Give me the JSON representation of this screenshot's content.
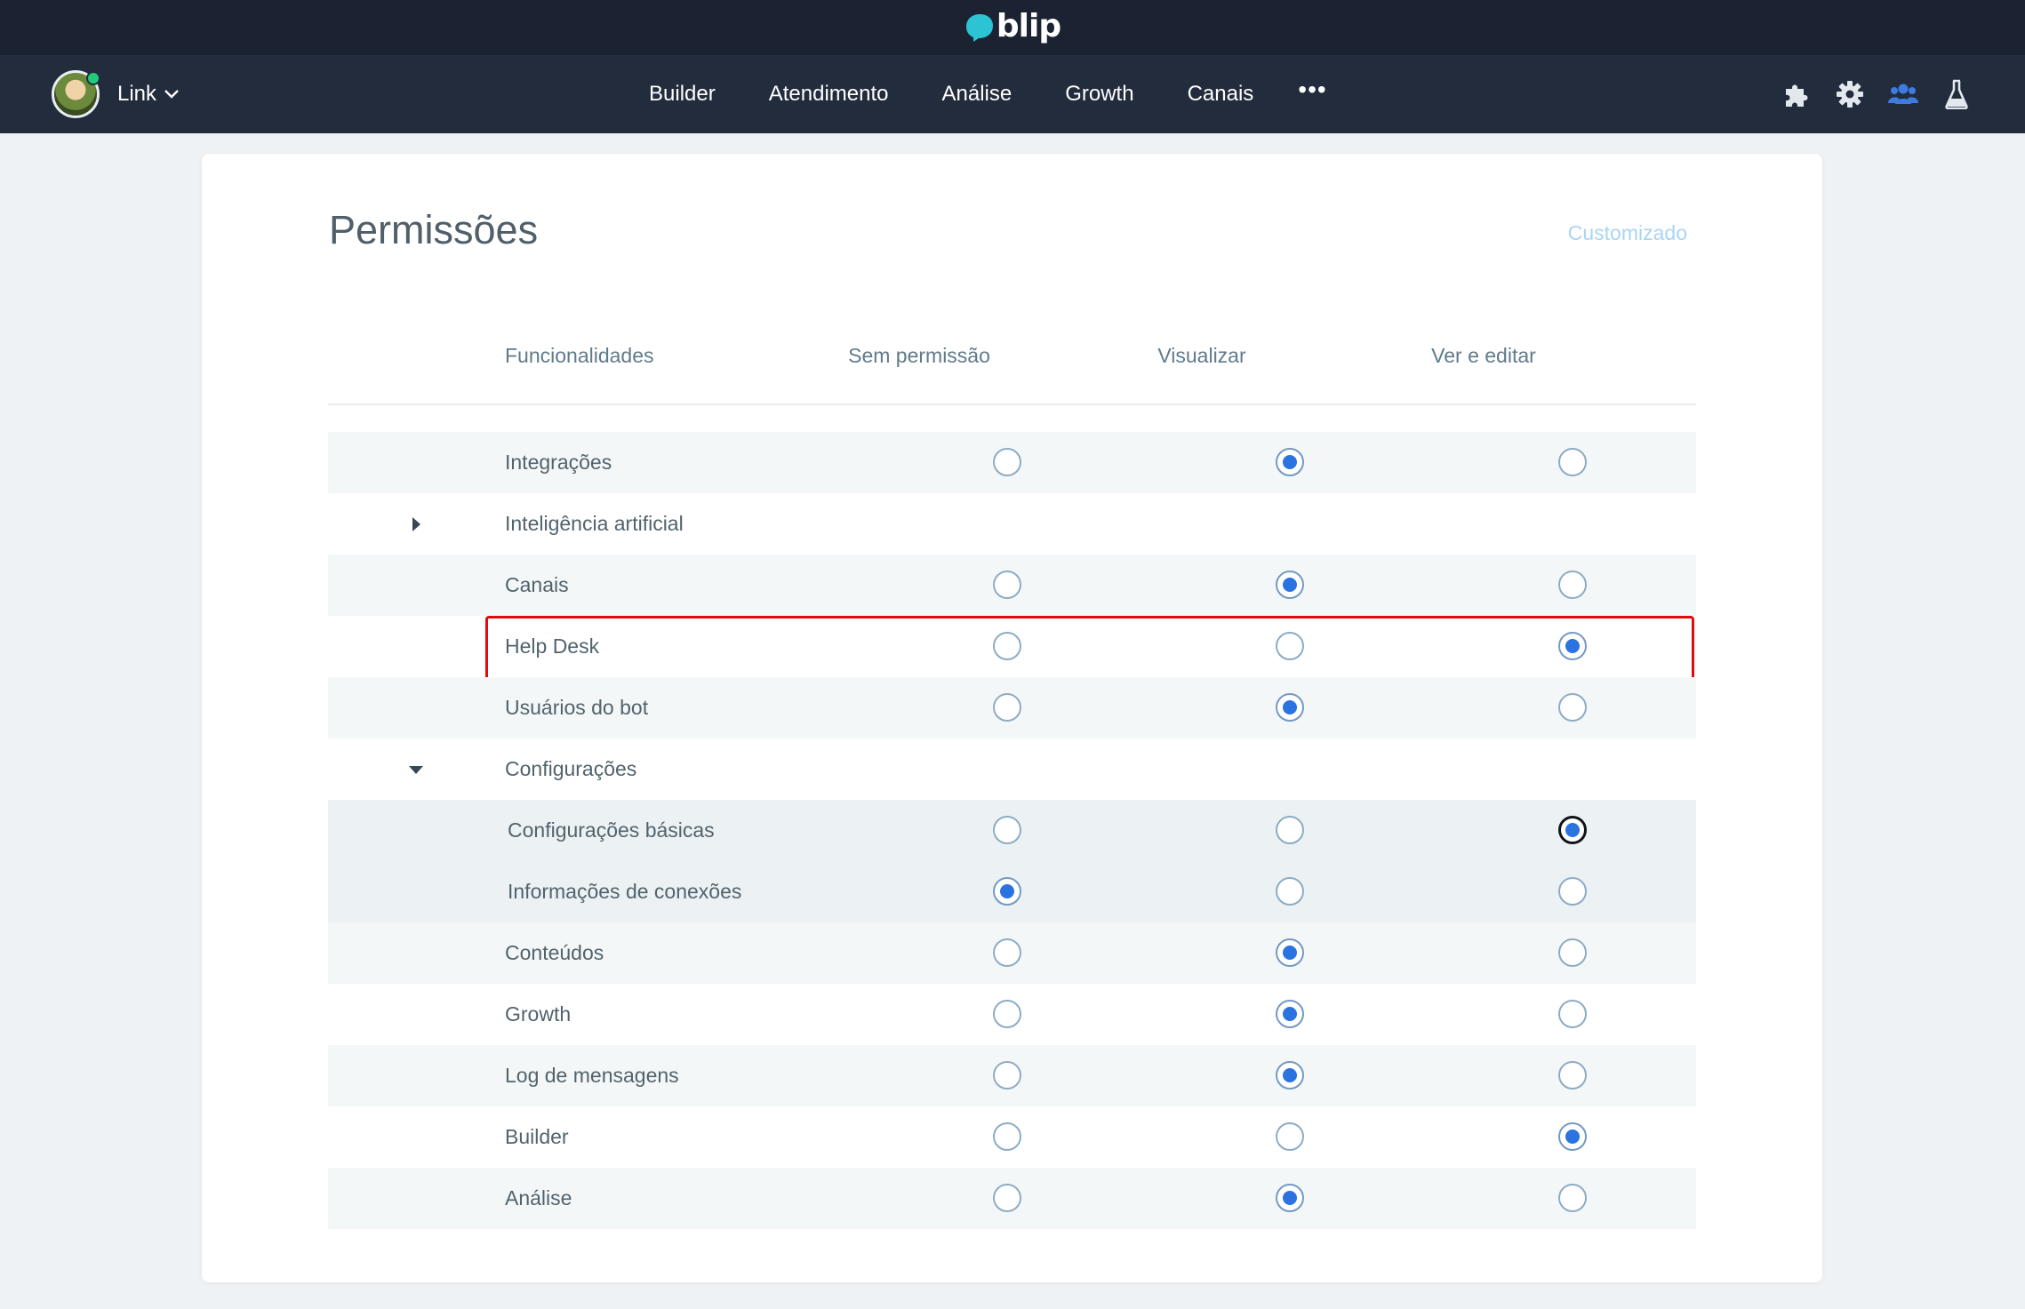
{
  "brand": {
    "logo_text": "blip"
  },
  "nav": {
    "bot_name": "Link",
    "menu": [
      "Builder",
      "Atendimento",
      "Análise",
      "Growth",
      "Canais"
    ],
    "more": "•••",
    "tools": [
      "puzzle-icon",
      "gear-icon",
      "team-icon",
      "flask-icon"
    ]
  },
  "page": {
    "title": "Permissões",
    "profile_type": "Customizado",
    "columns": [
      "Funcionalidades",
      "Sem permissão",
      "Visualizar",
      "Ver e editar"
    ],
    "rows": [
      {
        "label": "Integrações",
        "selected": 2
      },
      {
        "label": "Inteligência artificial",
        "group": "collapsed"
      },
      {
        "label": "Canais",
        "selected": 2
      },
      {
        "label": "Help Desk",
        "selected": 3,
        "highlighted": true
      },
      {
        "label": "Usuários do bot",
        "selected": 2
      },
      {
        "label": "Configurações",
        "group": "expanded"
      },
      {
        "label": "Configurações básicas",
        "selected": 3,
        "sub": true,
        "focused": true
      },
      {
        "label": "Informações de conexões",
        "selected": 1,
        "sub": true
      },
      {
        "label": "Conteúdos",
        "selected": 2
      },
      {
        "label": "Growth",
        "selected": 2
      },
      {
        "label": "Log de mensagens",
        "selected": 2
      },
      {
        "label": "Builder",
        "selected": 3
      },
      {
        "label": "Análise",
        "selected": 2
      }
    ]
  },
  "colors": {
    "header_bg": "#1b2332",
    "nav_bg": "#222c3d",
    "accent": "#2a73e0",
    "highlight_border": "#e00b10",
    "logo": "#2cc3d5"
  }
}
